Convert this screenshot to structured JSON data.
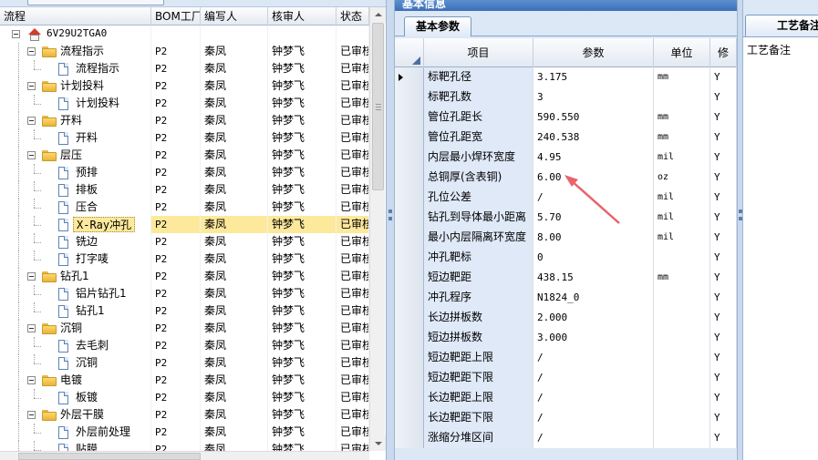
{
  "left_tree": {
    "columns": [
      "流程",
      "BOM工厂",
      "编写人",
      "核审人",
      "状态"
    ],
    "rows": [
      {
        "label": "6V29U2TGA0",
        "level": 0,
        "kind": "root",
        "factory": "",
        "writer": "",
        "reviewer": "",
        "status": "",
        "expanded": true
      },
      {
        "label": "流程指示",
        "level": 1,
        "kind": "folder",
        "factory": "P2",
        "writer": "秦凤",
        "reviewer": "钟梦飞",
        "status": "已审核",
        "expanded": true
      },
      {
        "label": "流程指示",
        "level": 2,
        "kind": "doc",
        "factory": "P2",
        "writer": "秦凤",
        "reviewer": "钟梦飞",
        "status": "已审核"
      },
      {
        "label": "计划投料",
        "level": 1,
        "kind": "folder",
        "factory": "P2",
        "writer": "秦凤",
        "reviewer": "钟梦飞",
        "status": "已审核",
        "expanded": true
      },
      {
        "label": "计划投料",
        "level": 2,
        "kind": "doc",
        "factory": "P2",
        "writer": "秦凤",
        "reviewer": "钟梦飞",
        "status": "已审核"
      },
      {
        "label": "开料",
        "level": 1,
        "kind": "folder",
        "factory": "P2",
        "writer": "秦凤",
        "reviewer": "钟梦飞",
        "status": "已审核",
        "expanded": true
      },
      {
        "label": "开料",
        "level": 2,
        "kind": "doc",
        "factory": "P2",
        "writer": "秦凤",
        "reviewer": "钟梦飞",
        "status": "已审核"
      },
      {
        "label": "层压",
        "level": 1,
        "kind": "folder",
        "factory": "P2",
        "writer": "秦凤",
        "reviewer": "钟梦飞",
        "status": "已审核",
        "expanded": true
      },
      {
        "label": "预排",
        "level": 2,
        "kind": "doc",
        "factory": "P2",
        "writer": "秦凤",
        "reviewer": "钟梦飞",
        "status": "已审核"
      },
      {
        "label": "排板",
        "level": 2,
        "kind": "doc",
        "factory": "P2",
        "writer": "秦凤",
        "reviewer": "钟梦飞",
        "status": "已审核"
      },
      {
        "label": "压合",
        "level": 2,
        "kind": "doc",
        "factory": "P2",
        "writer": "秦凤",
        "reviewer": "钟梦飞",
        "status": "已审核"
      },
      {
        "label": "X-Ray冲孔",
        "level": 2,
        "kind": "doc",
        "factory": "P2",
        "writer": "秦凤",
        "reviewer": "钟梦飞",
        "status": "已审核",
        "selected": true
      },
      {
        "label": "铣边",
        "level": 2,
        "kind": "doc",
        "factory": "P2",
        "writer": "秦凤",
        "reviewer": "钟梦飞",
        "status": "已审核"
      },
      {
        "label": "打字唛",
        "level": 2,
        "kind": "doc",
        "factory": "P2",
        "writer": "秦凤",
        "reviewer": "钟梦飞",
        "status": "已审核"
      },
      {
        "label": "钻孔1",
        "level": 1,
        "kind": "folder",
        "factory": "P2",
        "writer": "秦凤",
        "reviewer": "钟梦飞",
        "status": "已审核",
        "expanded": true
      },
      {
        "label": "铝片钻孔1",
        "level": 2,
        "kind": "doc",
        "factory": "P2",
        "writer": "秦凤",
        "reviewer": "钟梦飞",
        "status": "已审核"
      },
      {
        "label": "钻孔1",
        "level": 2,
        "kind": "doc",
        "factory": "P2",
        "writer": "秦凤",
        "reviewer": "钟梦飞",
        "status": "已审核"
      },
      {
        "label": "沉铜",
        "level": 1,
        "kind": "folder",
        "factory": "P2",
        "writer": "秦凤",
        "reviewer": "钟梦飞",
        "status": "已审核",
        "expanded": true
      },
      {
        "label": "去毛刺",
        "level": 2,
        "kind": "doc",
        "factory": "P2",
        "writer": "秦凤",
        "reviewer": "钟梦飞",
        "status": "已审核"
      },
      {
        "label": "沉铜",
        "level": 2,
        "kind": "doc",
        "factory": "P2",
        "writer": "秦凤",
        "reviewer": "钟梦飞",
        "status": "已审核"
      },
      {
        "label": "电镀",
        "level": 1,
        "kind": "folder",
        "factory": "P2",
        "writer": "秦凤",
        "reviewer": "钟梦飞",
        "status": "已审核",
        "expanded": true
      },
      {
        "label": "板镀",
        "level": 2,
        "kind": "doc",
        "factory": "P2",
        "writer": "秦凤",
        "reviewer": "钟梦飞",
        "status": "已审核"
      },
      {
        "label": "外层干膜",
        "level": 1,
        "kind": "folder",
        "factory": "P2",
        "writer": "秦凤",
        "reviewer": "钟梦飞",
        "status": "已审核",
        "expanded": true
      },
      {
        "label": "外层前处理",
        "level": 2,
        "kind": "doc",
        "factory": "P2",
        "writer": "秦凤",
        "reviewer": "钟梦飞",
        "status": "已审核"
      },
      {
        "label": "贴膜",
        "level": 2,
        "kind": "doc",
        "factory": "P2",
        "writer": "秦凤",
        "reviewer": "钟梦飞",
        "status": "已审核"
      }
    ]
  },
  "middle": {
    "window_title": "基本信息",
    "tab_label": "基本参数",
    "columns": [
      "项目",
      "参数",
      "单位",
      "修"
    ],
    "rows": [
      {
        "item": "标靶孔径",
        "value": "3.175",
        "unit": "mm",
        "flag": "Y",
        "current": true
      },
      {
        "item": "标靶孔数",
        "value": "3",
        "unit": "",
        "flag": "Y"
      },
      {
        "item": "管位孔距长",
        "value": "590.550",
        "unit": "mm",
        "flag": "Y"
      },
      {
        "item": "管位孔距宽",
        "value": "240.538",
        "unit": "mm",
        "flag": "Y"
      },
      {
        "item": "内层最小焊环宽度",
        "value": "4.95",
        "unit": "mil",
        "flag": "Y"
      },
      {
        "item": "总铜厚(含表铜)",
        "value": "6.00",
        "unit": "oz",
        "flag": "Y"
      },
      {
        "item": "孔位公差",
        "value": "/",
        "unit": "mil",
        "flag": "Y"
      },
      {
        "item": "钻孔到导体最小距离",
        "value": "5.70",
        "unit": "mil",
        "flag": "Y"
      },
      {
        "item": "最小内层隔离环宽度",
        "value": "8.00",
        "unit": "mil",
        "flag": "Y"
      },
      {
        "item": "冲孔靶标",
        "value": "0",
        "unit": "",
        "flag": "Y"
      },
      {
        "item": "短边靶距",
        "value": "438.15",
        "unit": "mm",
        "flag": "Y"
      },
      {
        "item": "冲孔程序",
        "value": "N1824_0",
        "unit": "",
        "flag": "Y"
      },
      {
        "item": "长边拼板数",
        "value": "2.000",
        "unit": "",
        "flag": "Y"
      },
      {
        "item": "短边拼板数",
        "value": "3.000",
        "unit": "",
        "flag": "Y"
      },
      {
        "item": "短边靶距上限",
        "value": "/",
        "unit": "",
        "flag": "Y"
      },
      {
        "item": "短边靶距下限",
        "value": "/",
        "unit": "",
        "flag": "Y"
      },
      {
        "item": "长边靶距上限",
        "value": "/",
        "unit": "",
        "flag": "Y"
      },
      {
        "item": "长边靶距下限",
        "value": "/",
        "unit": "",
        "flag": "Y"
      },
      {
        "item": "涨缩分堆区间",
        "value": "/",
        "unit": "",
        "flag": "Y"
      }
    ]
  },
  "right": {
    "tab_label": "工艺备注",
    "content_label": "工艺备注"
  },
  "colors": {
    "selection": "#fde99c",
    "item_cell": "#dfe9f7",
    "panel_bg": "#dce8f6",
    "annotation_arrow": "#e8636a"
  }
}
